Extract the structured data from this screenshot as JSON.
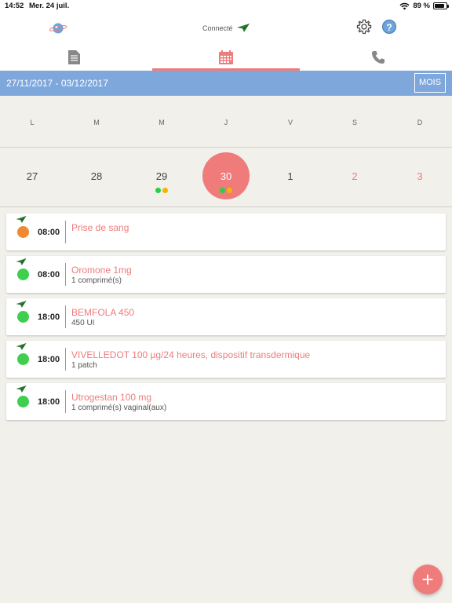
{
  "status_bar": {
    "time": "14:52",
    "date": "Mer. 24 juil.",
    "battery": "89 %",
    "battery_level": 0.89
  },
  "header": {
    "connection_label": "Connecté"
  },
  "tabs": [
    {
      "icon": "document-list-icon",
      "active": false
    },
    {
      "icon": "calendar-icon",
      "active": true
    },
    {
      "icon": "phone-icon",
      "active": false
    }
  ],
  "week": {
    "range": "27/11/2017 - 03/12/2017",
    "month_button": "MOIS"
  },
  "calendar": {
    "day_letters": [
      "L",
      "M",
      "M",
      "J",
      "V",
      "S",
      "D"
    ],
    "days": [
      {
        "num": "27"
      },
      {
        "num": "28"
      },
      {
        "num": "29",
        "dots": [
          "#2ecc4a",
          "#f5b400"
        ]
      },
      {
        "num": "30",
        "selected": true,
        "dots": [
          "#2ecc4a",
          "#f5b400"
        ]
      },
      {
        "num": "1"
      },
      {
        "num": "2",
        "weekend": true
      },
      {
        "num": "3",
        "weekend": true
      }
    ]
  },
  "colors": {
    "accent": "#ef7b7b",
    "week_bar": "#7ea7dc",
    "green": "#3fcf4f",
    "orange": "#ef8a30"
  },
  "events": [
    {
      "time": "08:00",
      "title": "Prise de sang",
      "subtitle": "",
      "status_color": "#ef8a30"
    },
    {
      "time": "08:00",
      "title": "Oromone 1mg",
      "subtitle": "1 comprimé(s)",
      "status_color": "#3fcf4f"
    },
    {
      "time": "18:00",
      "title": "BEMFOLA 450",
      "subtitle": "450 UI",
      "status_color": "#3fcf4f"
    },
    {
      "time": "18:00",
      "title": "VIVELLEDOT 100 µg/24 heures, dispositif transdermique",
      "subtitle": "1 patch",
      "status_color": "#3fcf4f"
    },
    {
      "time": "18:00",
      "title": "Utrogestan  100 mg",
      "subtitle": "1 comprimé(s) vaginal(aux)",
      "status_color": "#3fcf4f"
    }
  ],
  "fab": {
    "label": "+"
  }
}
